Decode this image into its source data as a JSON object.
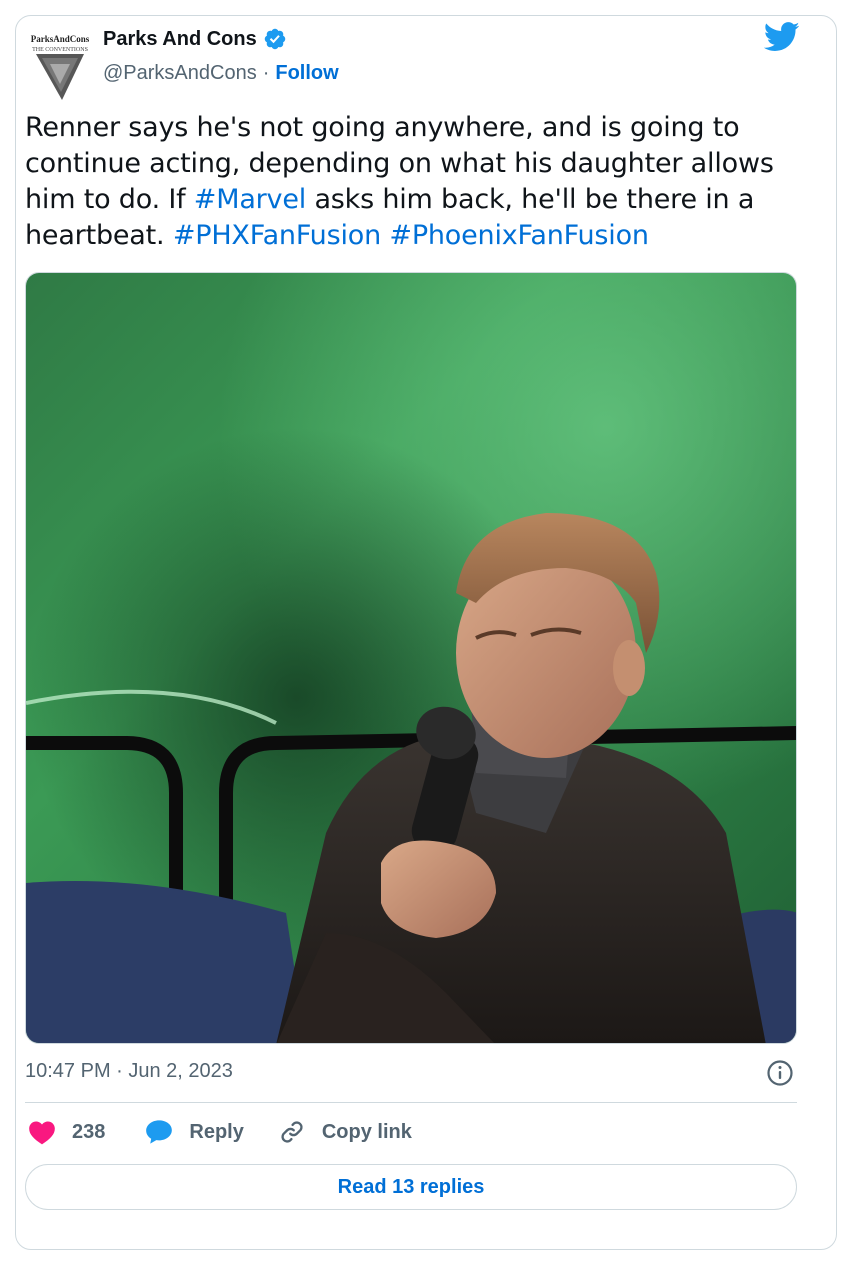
{
  "author": {
    "display_name": "Parks And Cons",
    "handle": "@ParksAndCons",
    "separator": "·",
    "follow_label": "Follow",
    "verified": true,
    "avatar_text_line1": "ParksAndCons",
    "avatar_text_line2": "THE CONVENTIONS"
  },
  "tweet": {
    "text_part1": "Renner says he's not going anywhere, and is going to continue acting, depending on what his daughter allows him to do. If ",
    "hashtag1": "#Marvel",
    "text_part2": " asks him back, he'll be there in a heartbeat. ",
    "hashtag2": "#PHXFanFusion",
    "hashtag3": "#PhoenixFanFusion"
  },
  "media": {
    "alt": "photo-of-man-in-leather-jacket-holding-microphone"
  },
  "meta": {
    "timestamp": "10:47 PM · Jun 2, 2023"
  },
  "actions": {
    "like_count": "238",
    "reply_label": "Reply",
    "copy_link_label": "Copy link"
  },
  "read_replies_label": "Read 13 replies",
  "colors": {
    "link_blue": "#006fd6",
    "twitter_blue": "#1d9bf0",
    "like_pink": "#f91880",
    "secondary_text": "#536471",
    "border": "#cfd9de"
  },
  "icons": [
    "verified-badge-icon",
    "twitter-bird-icon",
    "info-icon",
    "heart-icon",
    "reply-bubble-icon",
    "link-icon"
  ]
}
